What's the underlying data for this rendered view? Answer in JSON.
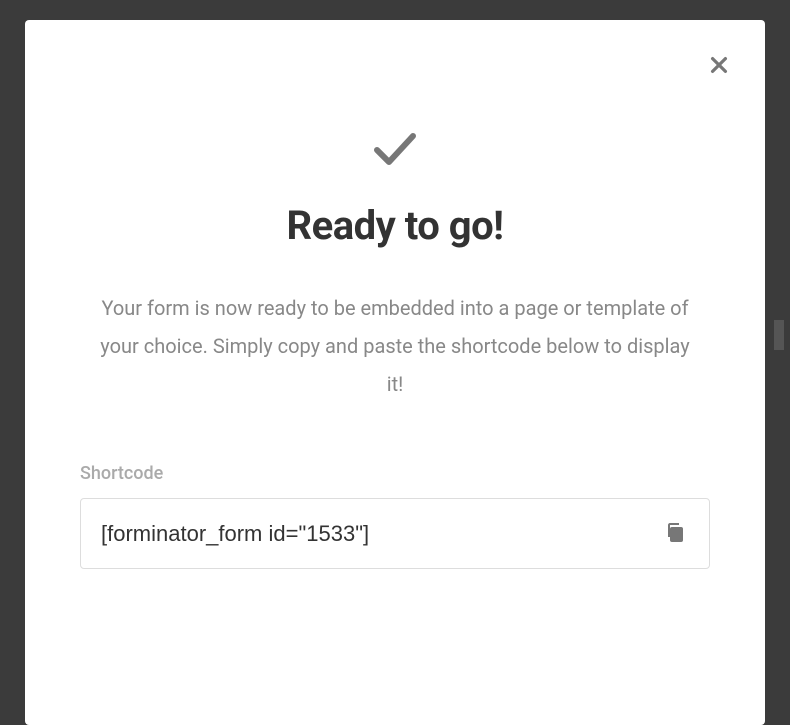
{
  "modal": {
    "title": "Ready to go!",
    "description": "Your form is now ready to be embedded into a page or template of your choice. Simply copy and paste the shortcode below to display it!",
    "shortcode_label": "Shortcode",
    "shortcode_value": "[forminator_form id=\"1533\"]"
  },
  "icons": {
    "close": "close-icon",
    "check": "check-icon",
    "copy": "copy-icon"
  }
}
